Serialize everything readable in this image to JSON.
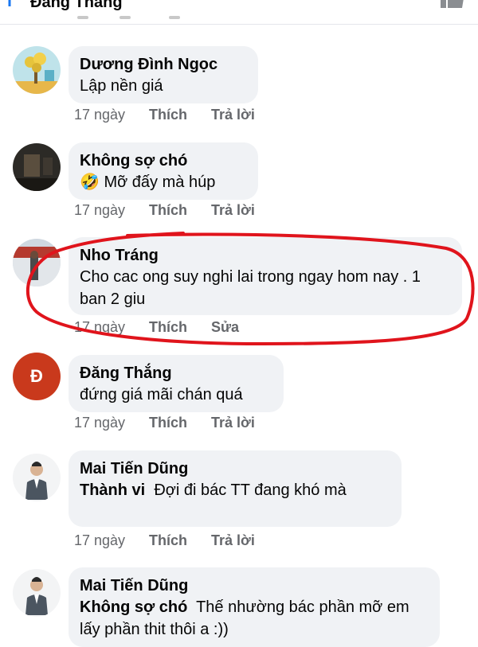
{
  "header": {
    "title": "Đăng Thắng"
  },
  "comments": [
    {
      "author": "Dương Đình Ngọc",
      "text": "Lập nền giá",
      "time": "17 ngày",
      "like_label": "Thích",
      "reply_label": "Trả lời",
      "avatar_icon": "tree-avatar"
    },
    {
      "author": "Không sợ chó",
      "emoji": "🤣",
      "text": "Mỡ đấy mà húp",
      "time": "17 ngày",
      "like_label": "Thích",
      "reply_label": "Trả lời",
      "avatar_icon": "dark-room-avatar"
    },
    {
      "author": "Nho Tráng",
      "text": "Cho  cac ong  suy  nghi  lai trong ngay hom nay .  1  ban 2  giu",
      "time": "17 ngày",
      "like_label": "Thích",
      "reply_label": "Sửa",
      "avatar_icon": "photo-avatar"
    },
    {
      "author": "Đăng Thắng",
      "avatar_letter": "Đ",
      "text": "đứng giá mãi chán quá",
      "time": "17 ngày",
      "like_label": "Thích",
      "reply_label": "Trả lời"
    },
    {
      "author": "Mai Tiến Dũng",
      "mention": "Thành vi",
      "text": "Đợi đi bác TT đang khó mà",
      "time": "17 ngày",
      "like_label": "Thích",
      "reply_label": "Trả lời",
      "avatar_icon": "person-suit-avatar"
    },
    {
      "author": "Mai Tiến Dũng",
      "mention": "Không sợ chó",
      "text": "Thế nhường bác phần mỡ em lấy phần thit thôi a :))",
      "avatar_icon": "person-suit-avatar"
    }
  ],
  "colors": {
    "bubble": "#f0f2f5",
    "meta": "#65676b",
    "annotation": "#e0141c",
    "avatar_letter_bg": "#c9391c"
  }
}
